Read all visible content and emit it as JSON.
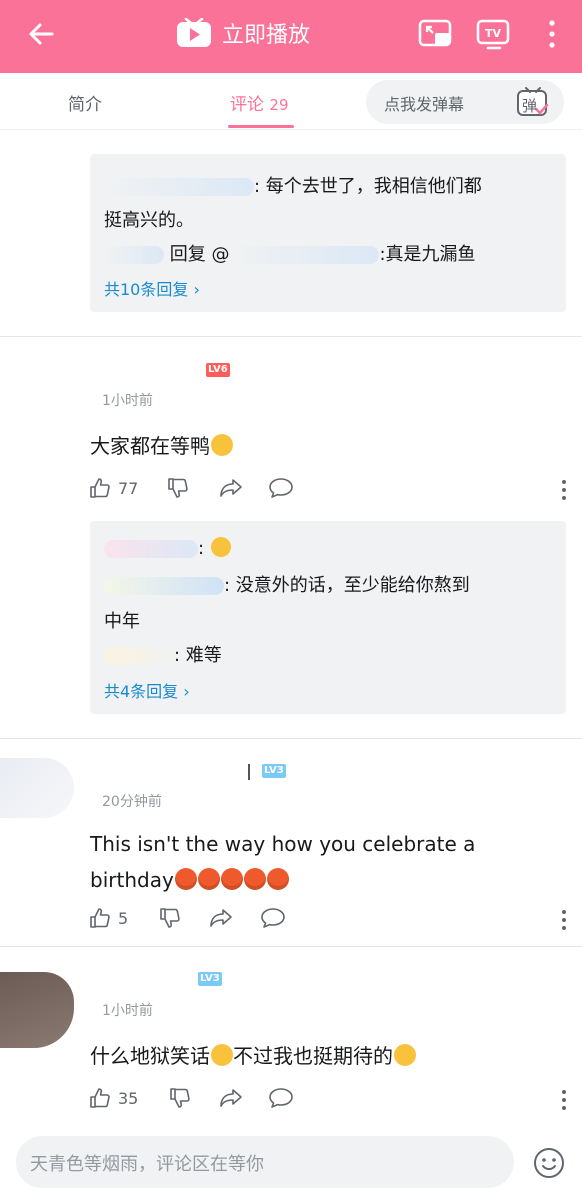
{
  "header": {
    "title": "立即播放",
    "colors": {
      "brand": "#fb7299",
      "link": "#178bcf",
      "text": "#18191c",
      "muted": "#9499a0"
    },
    "icons": [
      "back-arrow-icon",
      "tv-play-icon",
      "picture-in-picture-icon",
      "tv-cast-icon",
      "more-vertical-icon"
    ]
  },
  "tabs": {
    "intro": "简介",
    "comments": "评论",
    "comments_count": "29",
    "danmaku_placeholder": "点我发弹幕",
    "danmaku_icon": "弹"
  },
  "top_reply_box": {
    "line1": ": 每个去世了，我相信他们都",
    "line2": "挺高兴的。",
    "line3_prefix": "回复 @",
    "line3_suffix": ":真是九漏鱼",
    "more": "共10条回复"
  },
  "comments": [
    {
      "level": "LV6",
      "time": "1小时前",
      "text": "大家都在等鸭",
      "likes": "77",
      "replies": {
        "line1": ":",
        "line2": ": 没意外的话，至少能给你熬到",
        "line3": "中年",
        "line4": ": 难等",
        "more": "共4条回复"
      }
    },
    {
      "level": "LV3",
      "time": "20分钟前",
      "text_line1": "This isn't the way how you celebrate a",
      "text_line2": "birthday",
      "likes": "5"
    },
    {
      "level": "LV3",
      "time": "1小时前",
      "text_part1": "什么地狱笑话",
      "text_part2": "不过我也挺期待的",
      "likes": "35"
    }
  ],
  "composer": {
    "placeholder": "天青色等烟雨，评论区在等你"
  }
}
